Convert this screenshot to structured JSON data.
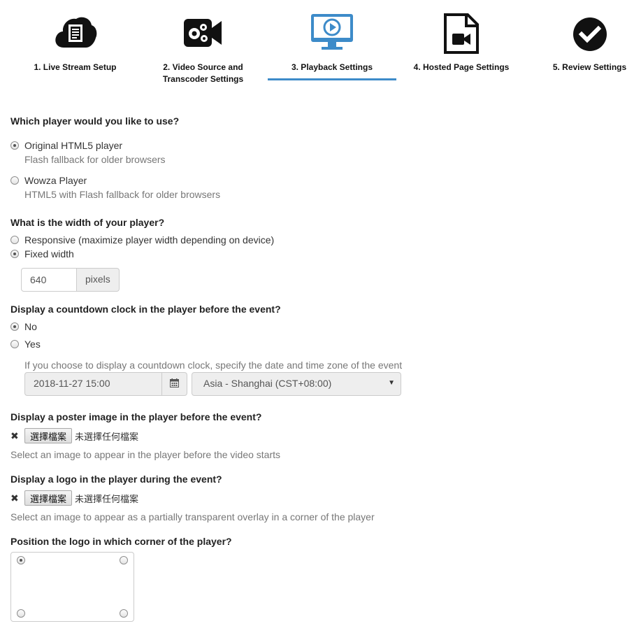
{
  "wizard": {
    "steps": [
      {
        "label": "1. Live Stream Setup",
        "icon": "cloud-document-icon"
      },
      {
        "label_line1": "2. Video Source and",
        "label_line2": "Transcoder Settings",
        "icon": "video-camera-gears-icon"
      },
      {
        "label": "3. Playback Settings",
        "icon": "monitor-play-icon",
        "active": true
      },
      {
        "label": "4. Hosted Page Settings",
        "icon": "video-file-icon"
      },
      {
        "label": "5. Review Settings",
        "icon": "checkmark-circle-icon"
      }
    ],
    "active_color": "#3d8bc9"
  },
  "player_type": {
    "question": "Which player would you like to use?",
    "options": [
      {
        "label": "Original HTML5 player",
        "sub": "Flash fallback for older browsers",
        "checked": true
      },
      {
        "label": "Wowza Player",
        "sub": "HTML5 with Flash fallback for older browsers",
        "checked": false
      }
    ]
  },
  "player_width": {
    "question": "What is the width of your player?",
    "options": [
      {
        "label": "Responsive (maximize player width depending on device)",
        "checked": false
      },
      {
        "label": "Fixed width",
        "checked": true
      }
    ],
    "width_value": "640",
    "unit": "pixels"
  },
  "countdown": {
    "question": "Display a countdown clock in the player before the event?",
    "options": [
      {
        "label": "No",
        "checked": true
      },
      {
        "label": "Yes",
        "checked": false
      }
    ],
    "help": "If you choose to display a countdown clock, specify the date and time zone of the event",
    "date_value": "2018-11-27 15:00",
    "timezone": "Asia - Shanghai (CST+08:00)"
  },
  "poster": {
    "question": "Display a poster image in the player before the event?",
    "clear": "✖",
    "button": "選擇檔案",
    "status": "未選擇任何檔案",
    "help": "Select an image to appear in the player before the video starts"
  },
  "logo": {
    "question": "Display a logo in the player during the event?",
    "clear": "✖",
    "button": "選擇檔案",
    "status": "未選擇任何檔案",
    "help": "Select an image to appear as a partially transparent overlay in a corner of the player"
  },
  "logo_position": {
    "question": "Position the logo in which corner of the player?",
    "selected": "top-left"
  }
}
